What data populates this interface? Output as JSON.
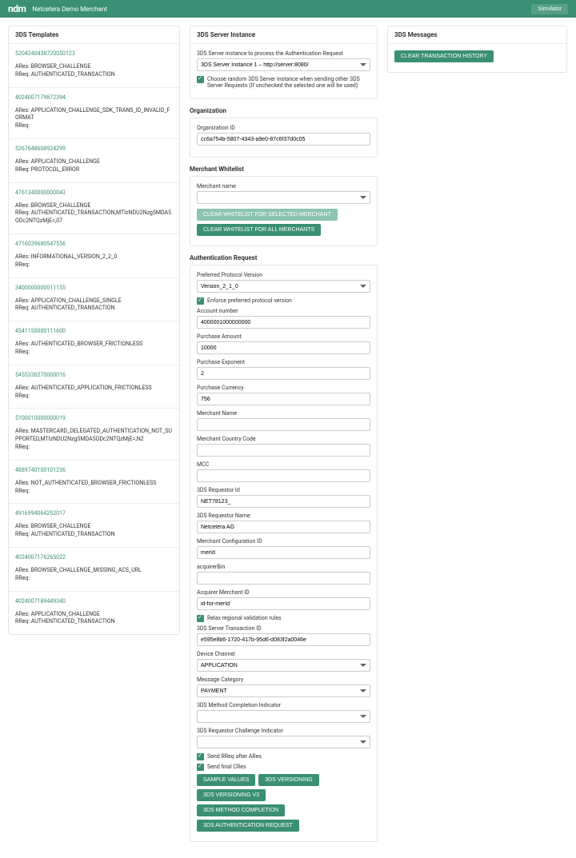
{
  "nav": {
    "logo": "ndm",
    "brand": "Netcetera Demo Merchant",
    "simulator_btn": "Simulator"
  },
  "templates": {
    "title": "3DS Templates",
    "items": [
      {
        "id": "5204240438720050123",
        "ares": "ARes: BROWSER_CHALLENGE",
        "rreq": "RReq: AUTHENTICATED_TRANSACTION"
      },
      {
        "id": "4024007179872394",
        "ares": "ARes: APPLICATION_CHALLENGE_SDK_TRANS_ID_INVALID_FORMAT",
        "rreq": "RReq:"
      },
      {
        "id": "5267648608924299",
        "ares": "ARes: APPLICATION_CHALLENGE",
        "rreq": "RReq: PROTOCOL_ERROR"
      },
      {
        "id": "4761340000000043",
        "ares": "ARes: BROWSER_CHALLENGE",
        "rreq": "RReq: AUTHENTICATED_TRANSACTION,MTIzNDU2Nzg5MDA5ODc2NTQzMjE=,07"
      },
      {
        "id": "4716039680547556",
        "ares": "ARes: INFORMATIONAL_VERSION_2_2_0",
        "rreq": "RReq:"
      },
      {
        "id": "3400000000011155",
        "ares": "ARes: APPLICATION_CHALLENGE_SINGLE",
        "rreq": "RReq: AUTHENTICATED_TRANSACTION"
      },
      {
        "id": "4541150000111600",
        "ares": "ARes: AUTHENTICATED_BROWSER_FRICTIONLESS",
        "rreq": "RReq:"
      },
      {
        "id": "5455330270000016",
        "ares": "ARes: AUTHENTICATED_APPLICATION_FRICTIONLESS",
        "rreq": "RReq:"
      },
      {
        "id": "5100010000000019",
        "ares": "ARes: MASTERCARD_DELEGATED_AUTHENTICATION_NOT_SUPPORTED,MTIzNDU2Nzg5MDA5ODc2NTQzMjE=,N2",
        "rreq": "RReq:"
      },
      {
        "id": "4889740100101236",
        "ares": "ARes: NOT_AUTHENTICATED_BROWSER_FRICTIONLESS",
        "rreq": "RReq:"
      },
      {
        "id": "4916994064252017",
        "ares": "ARes: BROWSER_CHALLENGE",
        "rreq": "RReq: AUTHENTICATED_TRANSACTION"
      },
      {
        "id": "4024007176265022",
        "ares": "ARes: BROWSER_CHALLENGE_MISSING_ACS_URL",
        "rreq": "RReq:"
      },
      {
        "id": "4024007189449340",
        "ares": "ARes: APPLICATION_CHALLENGE",
        "rreq": "RReq: AUTHENTICATED_TRANSACTION"
      }
    ]
  },
  "server": {
    "title": "3DS Server Instance",
    "label": "3DS Server instance to process the Authentication Request",
    "value": "3DS Server Instance 1 – http://server:8080/",
    "random_label": "Choose random 3DS Server instance when sending other 3DS Server Requests (If unchecked the selected one will be used)"
  },
  "org": {
    "title": "Organization",
    "id_label": "Organization ID",
    "id_value": "cc6a754b-5807-4343-a9e0-87c6f37d0c05"
  },
  "whitelist": {
    "title": "Merchant Whitelist",
    "name_label": "Merchant name",
    "clear_selected": "CLEAR WHITELIST FOR SELECTED MERCHANT",
    "clear_all": "CLEAR WHITELIST FOR ALL MERCHANTS"
  },
  "auth": {
    "title": "Authentication Request",
    "protocol_label": "Preferred Protocol Version",
    "protocol_value": "Version_2_1_0",
    "enforce_label": "Enforce preferred protocol version",
    "account_label": "Account number",
    "account_value": "4000001000000000",
    "amount_label": "Purchase Amount",
    "amount_value": "10000",
    "exponent_label": "Purchase Exponent",
    "exponent_value": "2",
    "currency_label": "Purchase Currency",
    "currency_value": "756",
    "merchant_name_label": "Merchant Name",
    "country_label": "Merchant Country Code",
    "mcc_label": "MCC",
    "requestor_id_label": "3DS Requestor Id",
    "requestor_id_value": "NET78123_",
    "requestor_name_label": "3DS Requestor Name",
    "requestor_name_value": "Netcetera AG",
    "config_id_label": "Merchant Configuration ID",
    "config_id_value": "merId",
    "acquirer_bin_label": "acquirerBin",
    "acquirer_merchant_label": "Acquirer Merchant ID",
    "acquirer_merchant_value": "id-for-merId",
    "relax_label": "Relax regional validation rules",
    "trans_id_label": "3DS Server Transaction ID",
    "trans_id_value": "e595e8b6-1720-417b-95d6-d083f2a0046e",
    "device_label": "Device Channel",
    "device_value": "APPLICATION",
    "message_label": "Message Category",
    "message_value": "PAYMENT",
    "completion_label": "3DS Method Completion Indicator",
    "challenge_label": "3DS Requestor Challenge Indicator",
    "send_rreq_label": "Send RReq after ARes",
    "send_cres_label": "Send final CRes",
    "btn_sample": "SAMPLE VALUES",
    "btn_versioning": "3DS VERSIONING",
    "btn_versioning_v3": "3DS VERSIONING V3",
    "btn_method": "3DS METHOD COMPLETION",
    "btn_auth_req": "3DS AUTHENTICATION REQUEST"
  },
  "messages": {
    "title": "3DS Messages",
    "clear_btn": "CLEAR TRANSACTION HISTORY"
  }
}
